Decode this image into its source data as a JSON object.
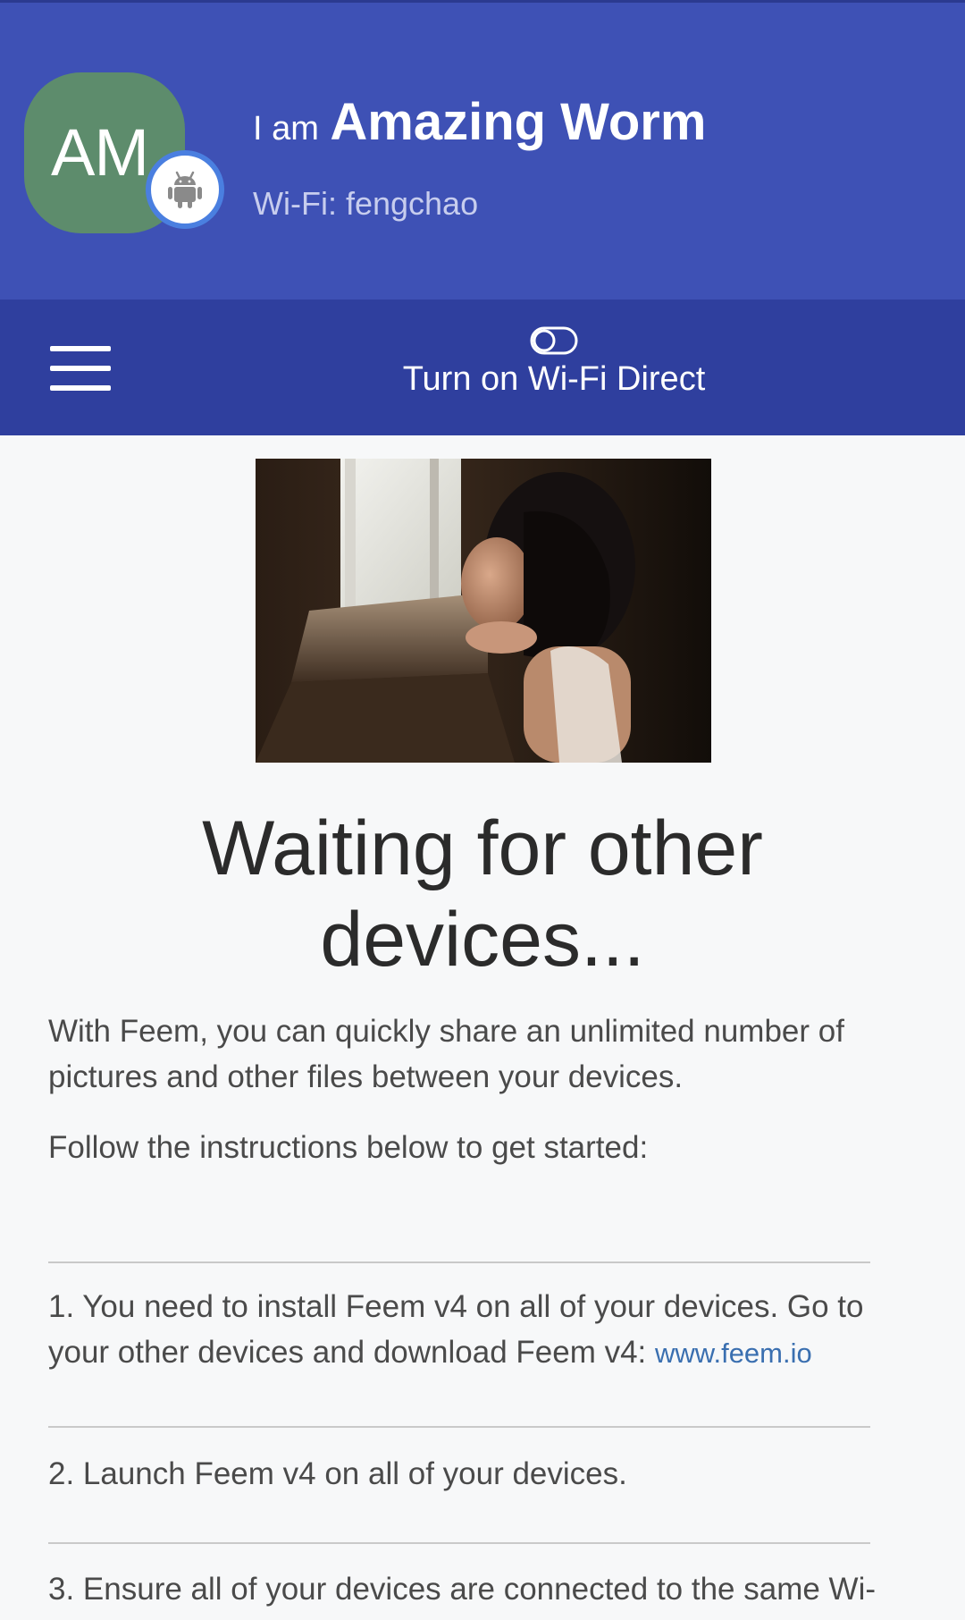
{
  "header": {
    "avatar_initials": "AM",
    "title_prefix": "I am",
    "device_name": "Amazing Worm",
    "wifi_status": "Wi-Fi: fengchao",
    "platform_icon": "android-icon",
    "colors": {
      "header_bg": "#3e51b5",
      "avatar_bg": "#5d8c6c"
    }
  },
  "toolbar": {
    "menu_icon": "hamburger-menu-icon",
    "toggle_icon": "toggle-off-icon",
    "wifi_direct_label": "Turn on Wi-Fi Direct",
    "colors": {
      "toolbar_bg": "#2f3f9e"
    }
  },
  "main": {
    "hero_image": "girl-looking-out-window-photo",
    "title": "Waiting for other devices...",
    "intro": "With Feem, you can quickly share an unlimited number of pictures and other files between your devices.",
    "instructions_lead": "Follow the instructions below to get started:",
    "steps": [
      {
        "text": "1. You need to install Feem v4 on all of your devices. Go to your other devices and download Feem v4:",
        "link": "www.feem.io"
      },
      {
        "text": "2. Launch Feem v4 on all of your devices."
      },
      {
        "text": "3. Ensure all of your devices are connected to the same Wi-"
      }
    ],
    "colors": {
      "link": "#3a6fb0"
    }
  }
}
